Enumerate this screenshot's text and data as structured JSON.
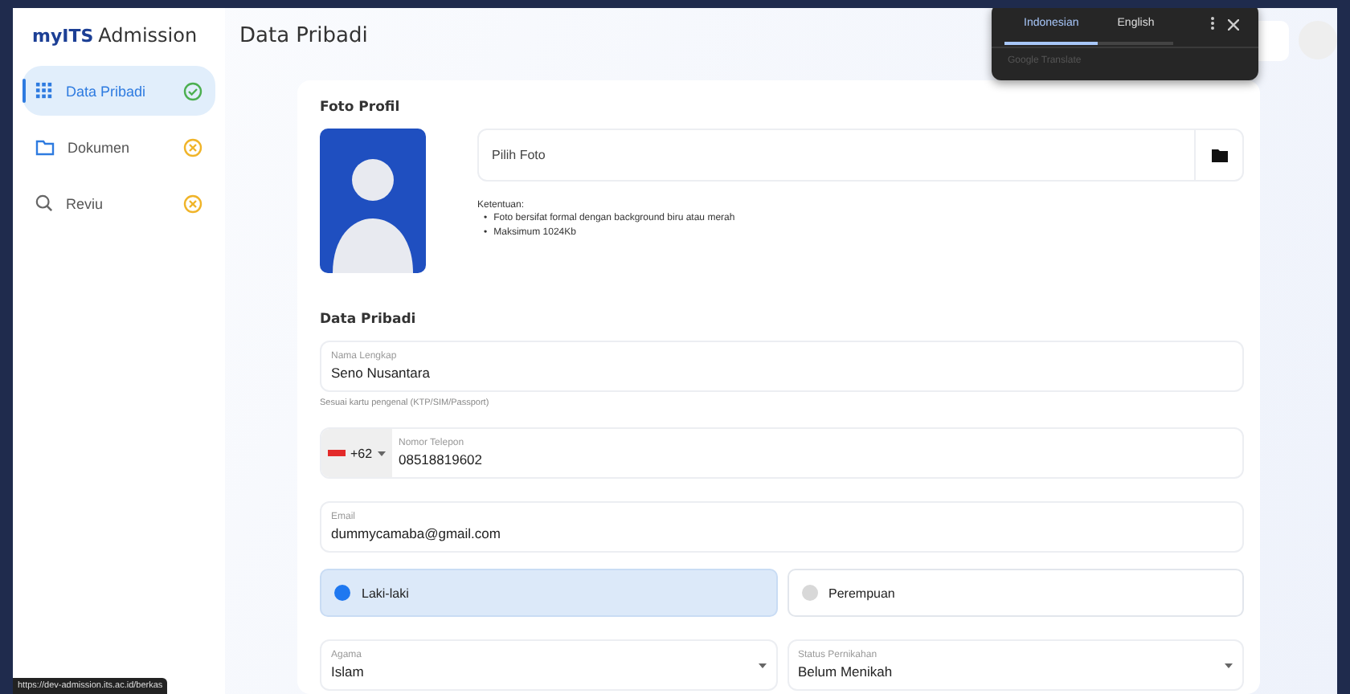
{
  "brand": {
    "mark": "myITS",
    "name": "Admission"
  },
  "sidebar": {
    "items": [
      {
        "label": "Data Pribadi",
        "kind": "grid",
        "complete": true,
        "selected": true
      },
      {
        "label": "Dokumen",
        "kind": "folder",
        "complete": false,
        "selected": false
      },
      {
        "label": "Reviu",
        "kind": "review",
        "complete": false,
        "selected": false
      }
    ]
  },
  "page_title": "Data Pribadi",
  "translate_popup": {
    "tabs": [
      {
        "label": "Indonesian",
        "selected": true
      },
      {
        "label": "English",
        "selected": false
      }
    ],
    "footer": "Google Translate"
  },
  "photo_section": {
    "title": "Foto Profil",
    "file_field": {
      "placeholder": "Pilih Foto"
    },
    "rules_title": "Ketentuan:",
    "rules": [
      {
        "marker": "•",
        "text": "Foto bersifat formal dengan background biru atau merah"
      },
      {
        "marker": "•",
        "text": "Maksimum 1024Kb"
      }
    ]
  },
  "personal_section": {
    "title": "Data Pribadi",
    "name_field": {
      "label": "Nama Lengkap",
      "value": "Seno Nusantara",
      "hint": "Sesuai kartu pengenal (KTP/SIM/Passport)"
    },
    "phone_field": {
      "country_code": "+62",
      "label": "Nomor Telepon",
      "value": "08518819602"
    },
    "email_field": {
      "label": "Email",
      "value": "dummycamaba@gmail.com"
    },
    "gender": [
      {
        "label": "Laki-laki",
        "selected": true
      },
      {
        "label": "Perempuan",
        "selected": false
      }
    ],
    "selects": [
      {
        "label": "Agama",
        "value": "Islam"
      },
      {
        "label": "Status Pernikahan",
        "value": "Belum Menikah"
      }
    ]
  },
  "status_url": "https://dev-admission.its.ac.id/berkas"
}
